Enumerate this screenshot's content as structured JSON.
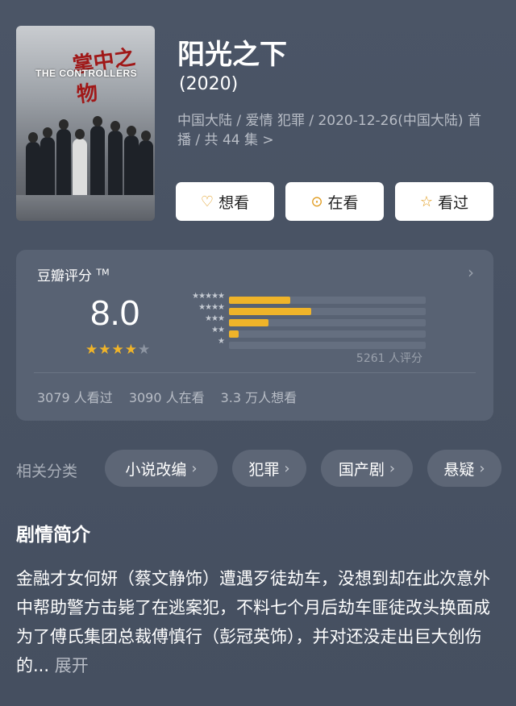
{
  "poster": {
    "cn_title": "掌中之物",
    "en_title": "THE CONTROLLERS"
  },
  "show": {
    "title": "阳光之下",
    "year": "(2020)",
    "meta": "中国大陆 / 爱情 犯罪 / 2020-12-26(中国大陆) 首播 / 共 44 集 >"
  },
  "actions": {
    "want": {
      "label": "想看",
      "icon": "heart-plus-icon"
    },
    "watching": {
      "label": "在看",
      "icon": "eye-icon"
    },
    "watched": {
      "label": "看过",
      "icon": "star-icon"
    }
  },
  "rating": {
    "label": "豆瓣评分",
    "tm": "TM",
    "score": "8.0",
    "stars_filled": 4,
    "stars_total": 5,
    "distribution": [
      {
        "stars": "★★★★★",
        "fraction": 0.31
      },
      {
        "stars": "★★★★",
        "fraction": 0.42
      },
      {
        "stars": "★★★",
        "fraction": 0.2
      },
      {
        "stars": "★★",
        "fraction": 0.05
      },
      {
        "stars": "★",
        "fraction": 0.0
      }
    ],
    "count": "5261 人评分",
    "stats": {
      "watched": "3079 人看过",
      "watching": "3090 人在看",
      "wanted": "3.3 万人想看"
    }
  },
  "related": {
    "label": "相关分类",
    "chips": [
      "小说改编",
      "犯罪",
      "国产剧",
      "悬疑"
    ]
  },
  "synopsis": {
    "title": "剧情简介",
    "text": "金融才女何妍（蔡文静饰）遭遇歹徒劫车，没想到却在此次意外中帮助警方击毙了在逃案犯，不料七个月后劫车匪徒改头换面成为了傅氏集团总裁傅慎行（彭冠英饰），并对还没走出巨大创伤的...",
    "more": "展开"
  },
  "colors": {
    "accent": "#f0b429",
    "background": "#4b5566",
    "card": "#586273"
  }
}
